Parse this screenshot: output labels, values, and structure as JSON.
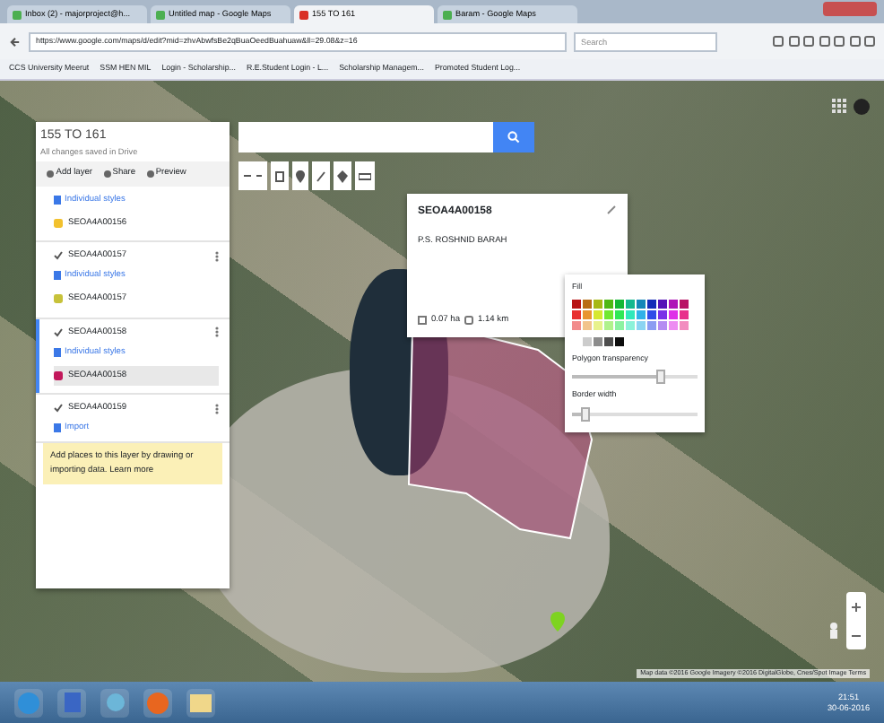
{
  "browser": {
    "tabs": [
      {
        "label": "Inbox (2) - majorproject@h...",
        "selected": false
      },
      {
        "label": "Untitled map - Google Maps",
        "selected": false
      },
      {
        "label": "155 TO 161",
        "selected": true
      },
      {
        "label": "Baram - Google Maps",
        "selected": false
      }
    ],
    "address": "https://www.google.com/maps/d/edit?mid=zhvAbwfsBe2qBuaOeedBuahuaw&ll=29.08&z=16",
    "search_placeholder": "Search",
    "bookmarks": [
      "CCS University Meerut",
      "SSM HEN MIL",
      "Login - Scholarship...",
      "R.E.Student Login - L...",
      "Scholarship Managem...",
      "Promoted Student Log..."
    ]
  },
  "panel": {
    "title": "155 TO 161",
    "status": "All changes saved in Drive",
    "actions": [
      "Add layer",
      "Share",
      "Preview"
    ],
    "layers": [
      {
        "selected": false,
        "style": "Individual styles",
        "items": [
          {
            "label": "SEOA4A00156",
            "color": "#f2c12e",
            "selected": false
          }
        ]
      },
      {
        "name": "SEOA4A00157",
        "checked": true,
        "selected": false,
        "style": "Individual styles",
        "items": [
          {
            "label": "SEOA4A00157",
            "color": "#c7c23a",
            "selected": false
          }
        ]
      },
      {
        "name": "SEOA4A00158",
        "checked": true,
        "selected": true,
        "style": "Individual styles",
        "items": [
          {
            "label": "SEOA4A00158",
            "color": "#c2185b",
            "selected": true
          }
        ]
      },
      {
        "name": "SEOA4A00159",
        "checked": true,
        "selected": false,
        "style": "Import"
      }
    ],
    "hint": "Add places to this layer by drawing or importing data. Learn more"
  },
  "popup": {
    "title": "SEOA4A00158",
    "description": "P.S. ROSHNID BARAH",
    "area": "0.07 ha",
    "perimeter": "1.14 km"
  },
  "color_picker": {
    "title": "Fill",
    "transparency": {
      "label": "Polygon transparency",
      "level": 0.72
    },
    "border": {
      "label": "Border width",
      "level": 0.12
    }
  },
  "map_footer": "Map data ©2016 Google Imagery ©2016 DigitalGlobe, Cnes/Spot Image Terms",
  "taskbar": {
    "time": "21:51",
    "date": "30-06-2016"
  }
}
